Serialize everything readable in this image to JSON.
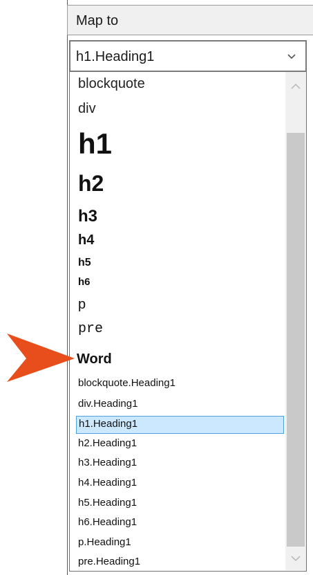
{
  "header": {
    "label": "Map to"
  },
  "combo": {
    "value": "h1.Heading1"
  },
  "list": {
    "html_items": [
      "blockquote",
      "div",
      "h1",
      "h2",
      "h3",
      "h4",
      "h5",
      "h6",
      "p",
      "pre"
    ],
    "group_label": "Word",
    "word_items": [
      "blockquote.Heading1",
      "div.Heading1",
      "h1.Heading1",
      "h2.Heading1",
      "h3.Heading1",
      "h4.Heading1",
      "h5.Heading1",
      "h6.Heading1",
      "p.Heading1",
      "pre.Heading1"
    ],
    "selected": "h1.Heading1"
  },
  "colors": {
    "selection_bg": "#cce8ff",
    "selection_border": "#4da3e0",
    "pointer_arrow": "#e84e1b"
  },
  "icons": [
    "chevron-down-icon",
    "scroll-up-arrow-icon",
    "scroll-down-arrow-icon",
    "pointer-arrow-icon"
  ]
}
